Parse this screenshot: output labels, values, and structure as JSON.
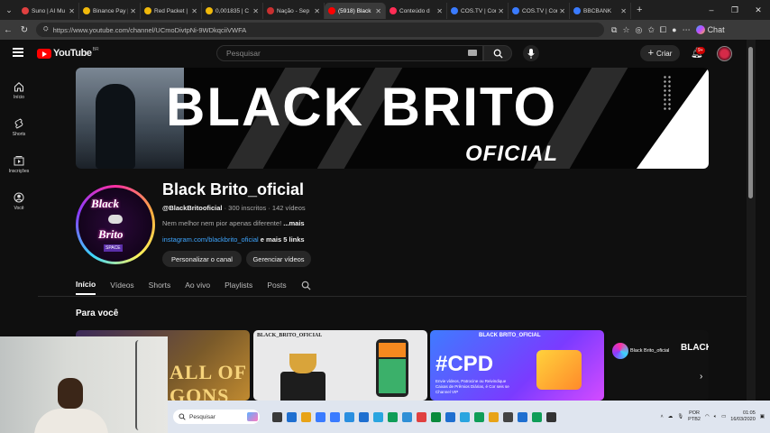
{
  "browser": {
    "tabs": [
      {
        "title": "Suno | AI Mu",
        "color": "#e04040"
      },
      {
        "title": "Binance Pay |",
        "color": "#f0b90b"
      },
      {
        "title": "Red Packet |",
        "color": "#f0b90b"
      },
      {
        "title": "0,001835 | C",
        "color": "#f0b90b"
      },
      {
        "title": "Nação - Sep",
        "color": "#c83030"
      },
      {
        "title": "(5918) Black",
        "color": "#ff0000",
        "active": true
      },
      {
        "title": "Conteúdo d",
        "color": "#ff2d55"
      },
      {
        "title": "COS.TV | Cor",
        "color": "#3a7bff"
      },
      {
        "title": "COS.TV | Cor",
        "color": "#3a7bff"
      },
      {
        "title": "BBCBANK",
        "color": "#3a7bff"
      }
    ],
    "url": "https://www.youtube.com/channel/UCmoDivtpNi-9WDkqciiVWFA",
    "chat_label": "Chat"
  },
  "youtube": {
    "logo_text": "YouTube",
    "logo_cc": "BR",
    "search_placeholder": "Pesquisar",
    "create_label": "Criar",
    "notif_count": "9+"
  },
  "sidebar": {
    "items": [
      {
        "label": "Início"
      },
      {
        "label": "Shorts"
      },
      {
        "label": "Inscrições"
      },
      {
        "label": "Você"
      }
    ]
  },
  "banner": {
    "title": "BLACK BRITO",
    "subtitle": "OFICIAL"
  },
  "channel": {
    "avatar_line1": "Black",
    "avatar_line2": "Brito",
    "avatar_tag": "SPACE",
    "name": "Black Brito_oficial",
    "handle": "@BlackBritooficial",
    "stats": " · 300 inscritos · 142 vídeos",
    "description": "Nem melhor nem pior apenas diferente! ",
    "more": "...mais",
    "link": "instagram.com/blackbrito_oficial",
    "more_links": " e mais 5 links",
    "btn_customize": "Personalizar o canal",
    "btn_manage": "Gerenciar vídeos"
  },
  "tabs": [
    "Início",
    "Vídeos",
    "Shorts",
    "Ao vivo",
    "Playlists",
    "Posts"
  ],
  "section_title": "Para você",
  "thumbnails": {
    "t1_text": "ALL OF GONS",
    "t2_caption": "BLACK_BRITO_OFICIAL",
    "t3_caption": "BLACK BRITO_OFICIAL",
    "t3_big": "#CPD",
    "t3_sub": "Envie vídeos, Patrocine ou Reivindique Caixas de Prêmios Diárias, é Cor seis se Channel VIP",
    "t4_name": "Black Brito_oficial",
    "t4_big": "BLACK"
  },
  "taskbar": {
    "search": "Pesquisar",
    "lang": "POR",
    "lang2": "PTB2",
    "time": "01:05",
    "date": "16/03/2020"
  }
}
